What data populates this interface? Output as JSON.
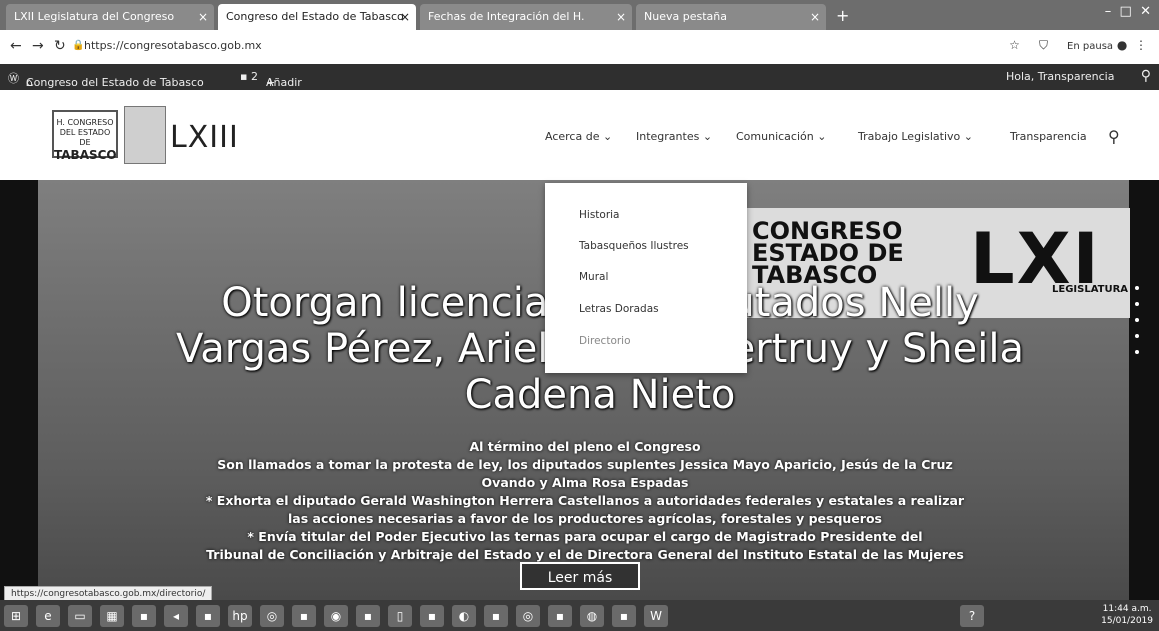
{
  "browser": {
    "tabs": [
      {
        "title": "LXII Legislatura del Congreso"
      },
      {
        "title": "Congreso del Estado de Tabasco"
      },
      {
        "title": "Fechas de Integración del H."
      },
      {
        "title": "Nueva pestaña"
      }
    ],
    "url": "https://congresotabasco.gob.mx",
    "pause_label": "En pausa"
  },
  "adminbar": {
    "site": "Congreso del Estado de Tabasco",
    "add": "Añadir",
    "greeting": "Hola, Transparencia"
  },
  "header": {
    "logo_line1": "H. CONGRESO",
    "logo_line2": "DEL ESTADO DE",
    "logo_line3": "TABASCO",
    "legislature": "LXIII",
    "menu": [
      "Acerca de ⌄",
      "Integrantes ⌄",
      "Comunicación ⌄",
      "Trabajo Legislativo ⌄",
      "Transparencia"
    ]
  },
  "dropdown": {
    "items": [
      "Historia",
      "Tabasqueños Ilustres",
      "Mural",
      "Letras Doradas",
      "Directorio"
    ]
  },
  "hero": {
    "banner_text": [
      "CONGRESO",
      "ESTADO DE",
      "TABASCO"
    ],
    "banner_lxi": "LXI",
    "banner_leg": "LEGISLATURA",
    "headline": "Otorgan licencia a los diputados Nelly Vargas Pérez, Ariel Cetina Bertruy y Sheila Cadena Nieto",
    "sub": [
      "Al término del pleno el Congreso",
      "Son llamados a tomar la protesta de ley, los diputados suplentes Jessica Mayo Aparicio, Jesús de la Cruz",
      "Ovando y Alma Rosa Espadas",
      "* Exhorta el diputado Gerald Washington Herrera Castellanos a autoridades federales y estatales a realizar",
      "las acciones necesarias a favor de los productores agrícolas, forestales y pesqueros",
      "* Envía titular del Poder Ejecutivo las ternas para ocupar el cargo de Magistrado Presidente del",
      "Tribunal de Conciliación y Arbitraje del Estado y el de Directora General del Instituto Estatal de las Mujeres"
    ],
    "read_more": "Leer más"
  },
  "status_url": "https://congresotabasco.gob.mx/directorio/",
  "taskbar": {
    "time": "11:44 a.m.",
    "date": "15/01/2019"
  }
}
